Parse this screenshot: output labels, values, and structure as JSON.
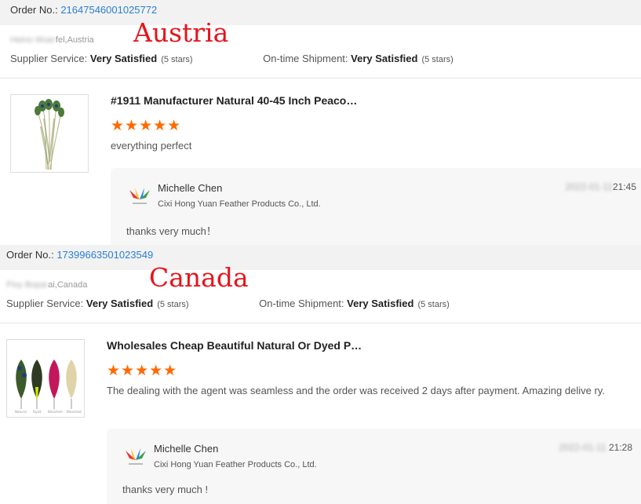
{
  "orders": [
    {
      "order_label": "Order No.:",
      "order_number": "21647546001025772",
      "buyer_masked": "Heino Wuer",
      "buyer_suffix": "fel,Austria",
      "country_overlay": "Austria",
      "supplier_service_label": "Supplier Service:",
      "supplier_service_value": "Very Satisfied",
      "supplier_service_stars": "(5 stars)",
      "shipment_label": "On-time Shipment:",
      "shipment_value": "Very Satisfied",
      "shipment_stars": "(5 stars)",
      "product_title": "#1911 Manufacturer Natural 40-45 Inch Peaco…",
      "rating_stars": "★★★★★",
      "rating": 5,
      "review_text": "everything perfect",
      "reply": {
        "name": "Michelle Chen",
        "company": "Cixi Hong Yuan Feather Products Co., Ltd.",
        "date_masked": "2022-01-11",
        "time": "21:45",
        "text": "thanks very much！"
      }
    },
    {
      "order_label": "Order No.:",
      "order_number": "17399663501023549",
      "buyer_masked": "Pixy Bopar",
      "buyer_suffix": "ai,Canada",
      "country_overlay": "Canada",
      "supplier_service_label": "Supplier Service:",
      "supplier_service_value": "Very Satisfied",
      "supplier_service_stars": "(5 stars)",
      "shipment_label": "On-time Shipment:",
      "shipment_value": "Very Satisfied",
      "shipment_stars": "(5 stars)",
      "product_title": "Wholesales Cheap Beautiful Natural Or Dyed P…",
      "rating_stars": "★★★★★",
      "rating": 5,
      "review_text": "The dealing with the agent was seamless and the order was received 2 days after payment. Amazing delive ry.",
      "reply": {
        "name": "Michelle Chen",
        "company": "Cixi Hong Yuan Feather Products Co., Ltd.",
        "date_masked": "2022-01-11",
        "time": "21:28",
        "text": "thanks very much !"
      }
    }
  ],
  "colors": {
    "accent_link": "#2a7fd4",
    "star": "#ff6a00",
    "overlay_red": "#e8141b"
  },
  "icons": [
    "peacock-feather-thumbnail",
    "dyed-feathers-thumbnail",
    "hong-yuan-logo-icon"
  ]
}
